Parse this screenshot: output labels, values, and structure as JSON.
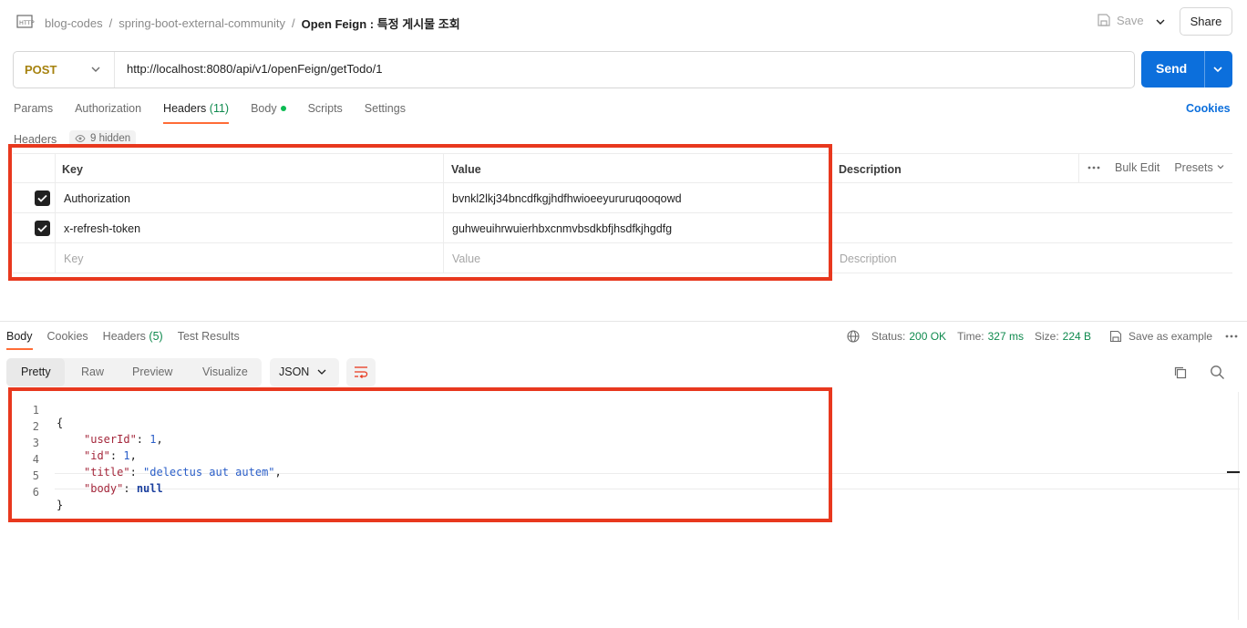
{
  "breadcrumb": {
    "workspace": "blog-codes",
    "collection": "spring-boot-external-community",
    "request": "Open Feign : 특정 게시물 조회"
  },
  "topbar": {
    "save_label": "Save",
    "share_label": "Share"
  },
  "request": {
    "method": "POST",
    "method_color": "#a6820e",
    "url": "http://localhost:8080/api/v1/openFeign/getTodo/1",
    "send_label": "Send"
  },
  "req_tabs": {
    "params": "Params",
    "authorization": "Authorization",
    "headers": "Headers",
    "headers_count": "(11)",
    "body": "Body",
    "scripts": "Scripts",
    "settings": "Settings",
    "cookies": "Cookies"
  },
  "headers_section": {
    "title": "Headers",
    "hidden_label": "9 hidden",
    "col_key": "Key",
    "col_value": "Value",
    "col_description": "Description",
    "bulk_edit": "Bulk Edit",
    "presets": "Presets",
    "rows": [
      {
        "key": "Authorization",
        "value": "bvnkl2lkj34bncdfkgjhdfhwioeeyururuqooqowd",
        "checked": true
      },
      {
        "key": "x-refresh-token",
        "value": "guhweuihrwuierhbxcnmvbsdkbfjhsdfkjhgdfg",
        "checked": true
      }
    ],
    "placeholder_key": "Key",
    "placeholder_value": "Value",
    "placeholder_description": "Description"
  },
  "response": {
    "tabs": {
      "body": "Body",
      "cookies": "Cookies",
      "headers": "Headers",
      "headers_count": "(5)",
      "test_results": "Test Results"
    },
    "status_label": "Status:",
    "status_value": "200 OK",
    "time_label": "Time:",
    "time_value": "327 ms",
    "size_label": "Size:",
    "size_value": "224 B",
    "save_example": "Save as example",
    "formats": {
      "pretty": "Pretty",
      "raw": "Raw",
      "preview": "Preview",
      "visualize": "Visualize"
    },
    "language": "JSON",
    "code": {
      "line_numbers": [
        "1",
        "2",
        "3",
        "4",
        "5",
        "6"
      ],
      "open_brace": "{",
      "close_brace": "}",
      "fields": [
        {
          "key": "\"userId\"",
          "value": "1",
          "type": "number",
          "comma": ","
        },
        {
          "key": "\"id\"",
          "value": "1",
          "type": "number",
          "comma": ","
        },
        {
          "key": "\"title\"",
          "value": "\"delectus aut autem\"",
          "type": "string",
          "comma": ","
        },
        {
          "key": "\"body\"",
          "value": "null",
          "type": "null",
          "comma": ""
        }
      ]
    }
  },
  "colors": {
    "accent_tab": "#ff6c37",
    "send": "#0c6fdc",
    "highlight": "#e8381e",
    "status_ok": "#0f8a4e"
  }
}
